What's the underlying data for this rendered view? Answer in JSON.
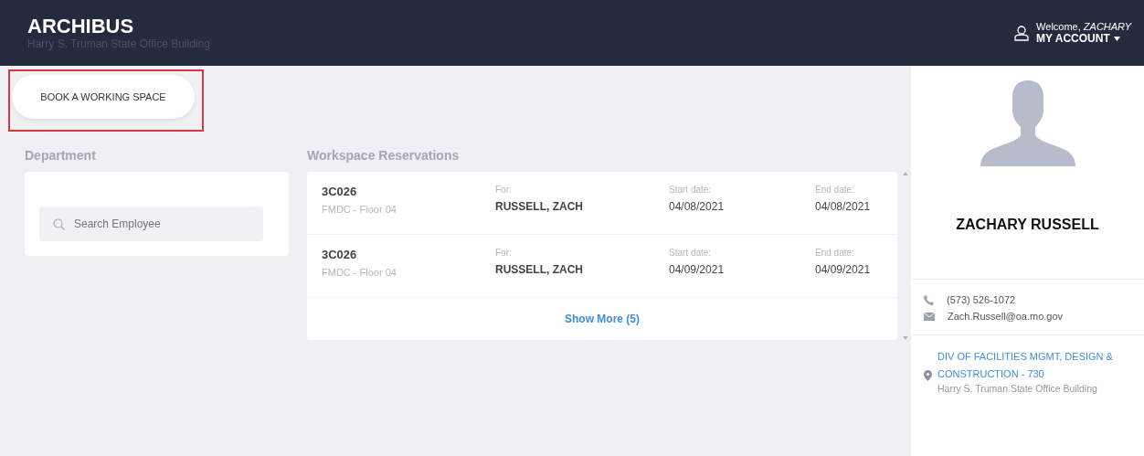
{
  "header": {
    "logo": "ARCHIBUS",
    "building": "Harry S. Truman State Office Building",
    "welcome": "Welcome, *ZACHARY*",
    "account": "MY ACCOUNT"
  },
  "book_button": {
    "label": "BOOK A WORKING SPACE",
    "highlighted": true
  },
  "department": {
    "title": "Department",
    "search": {
      "placeholder": "Search Employee"
    }
  },
  "reservations": {
    "title": "Workspace Reservations",
    "rows": [
      {
        "room": "3C026",
        "location": "FMDC - Floor 04",
        "for_label": "For:",
        "for": "RUSSELL, ZACH",
        "start_label": "Start date:",
        "start": "04/08/2021",
        "end_label": "End date:",
        "end": "04/08/2021"
      },
      {
        "room": "3C026",
        "location": "FMDC - Floor 04",
        "for_label": "For:",
        "for": "RUSSELL, ZACH",
        "start_label": "Start date:",
        "start": "04/09/2021",
        "end_label": "End date:",
        "end": "04/09/2021"
      }
    ],
    "show_more": "Show More (5)"
  },
  "profile": {
    "name": "ZACHARY RUSSELL",
    "phone": "(573) 526-1072",
    "email": "Zach.Russell@oa.mo.gov",
    "department_lines": [
      "DIV OF FACILITIES MGMT, DESIGN &",
      "CONSTRUCTION - 730"
    ],
    "building": "Harry S. Truman State Office Building"
  }
}
